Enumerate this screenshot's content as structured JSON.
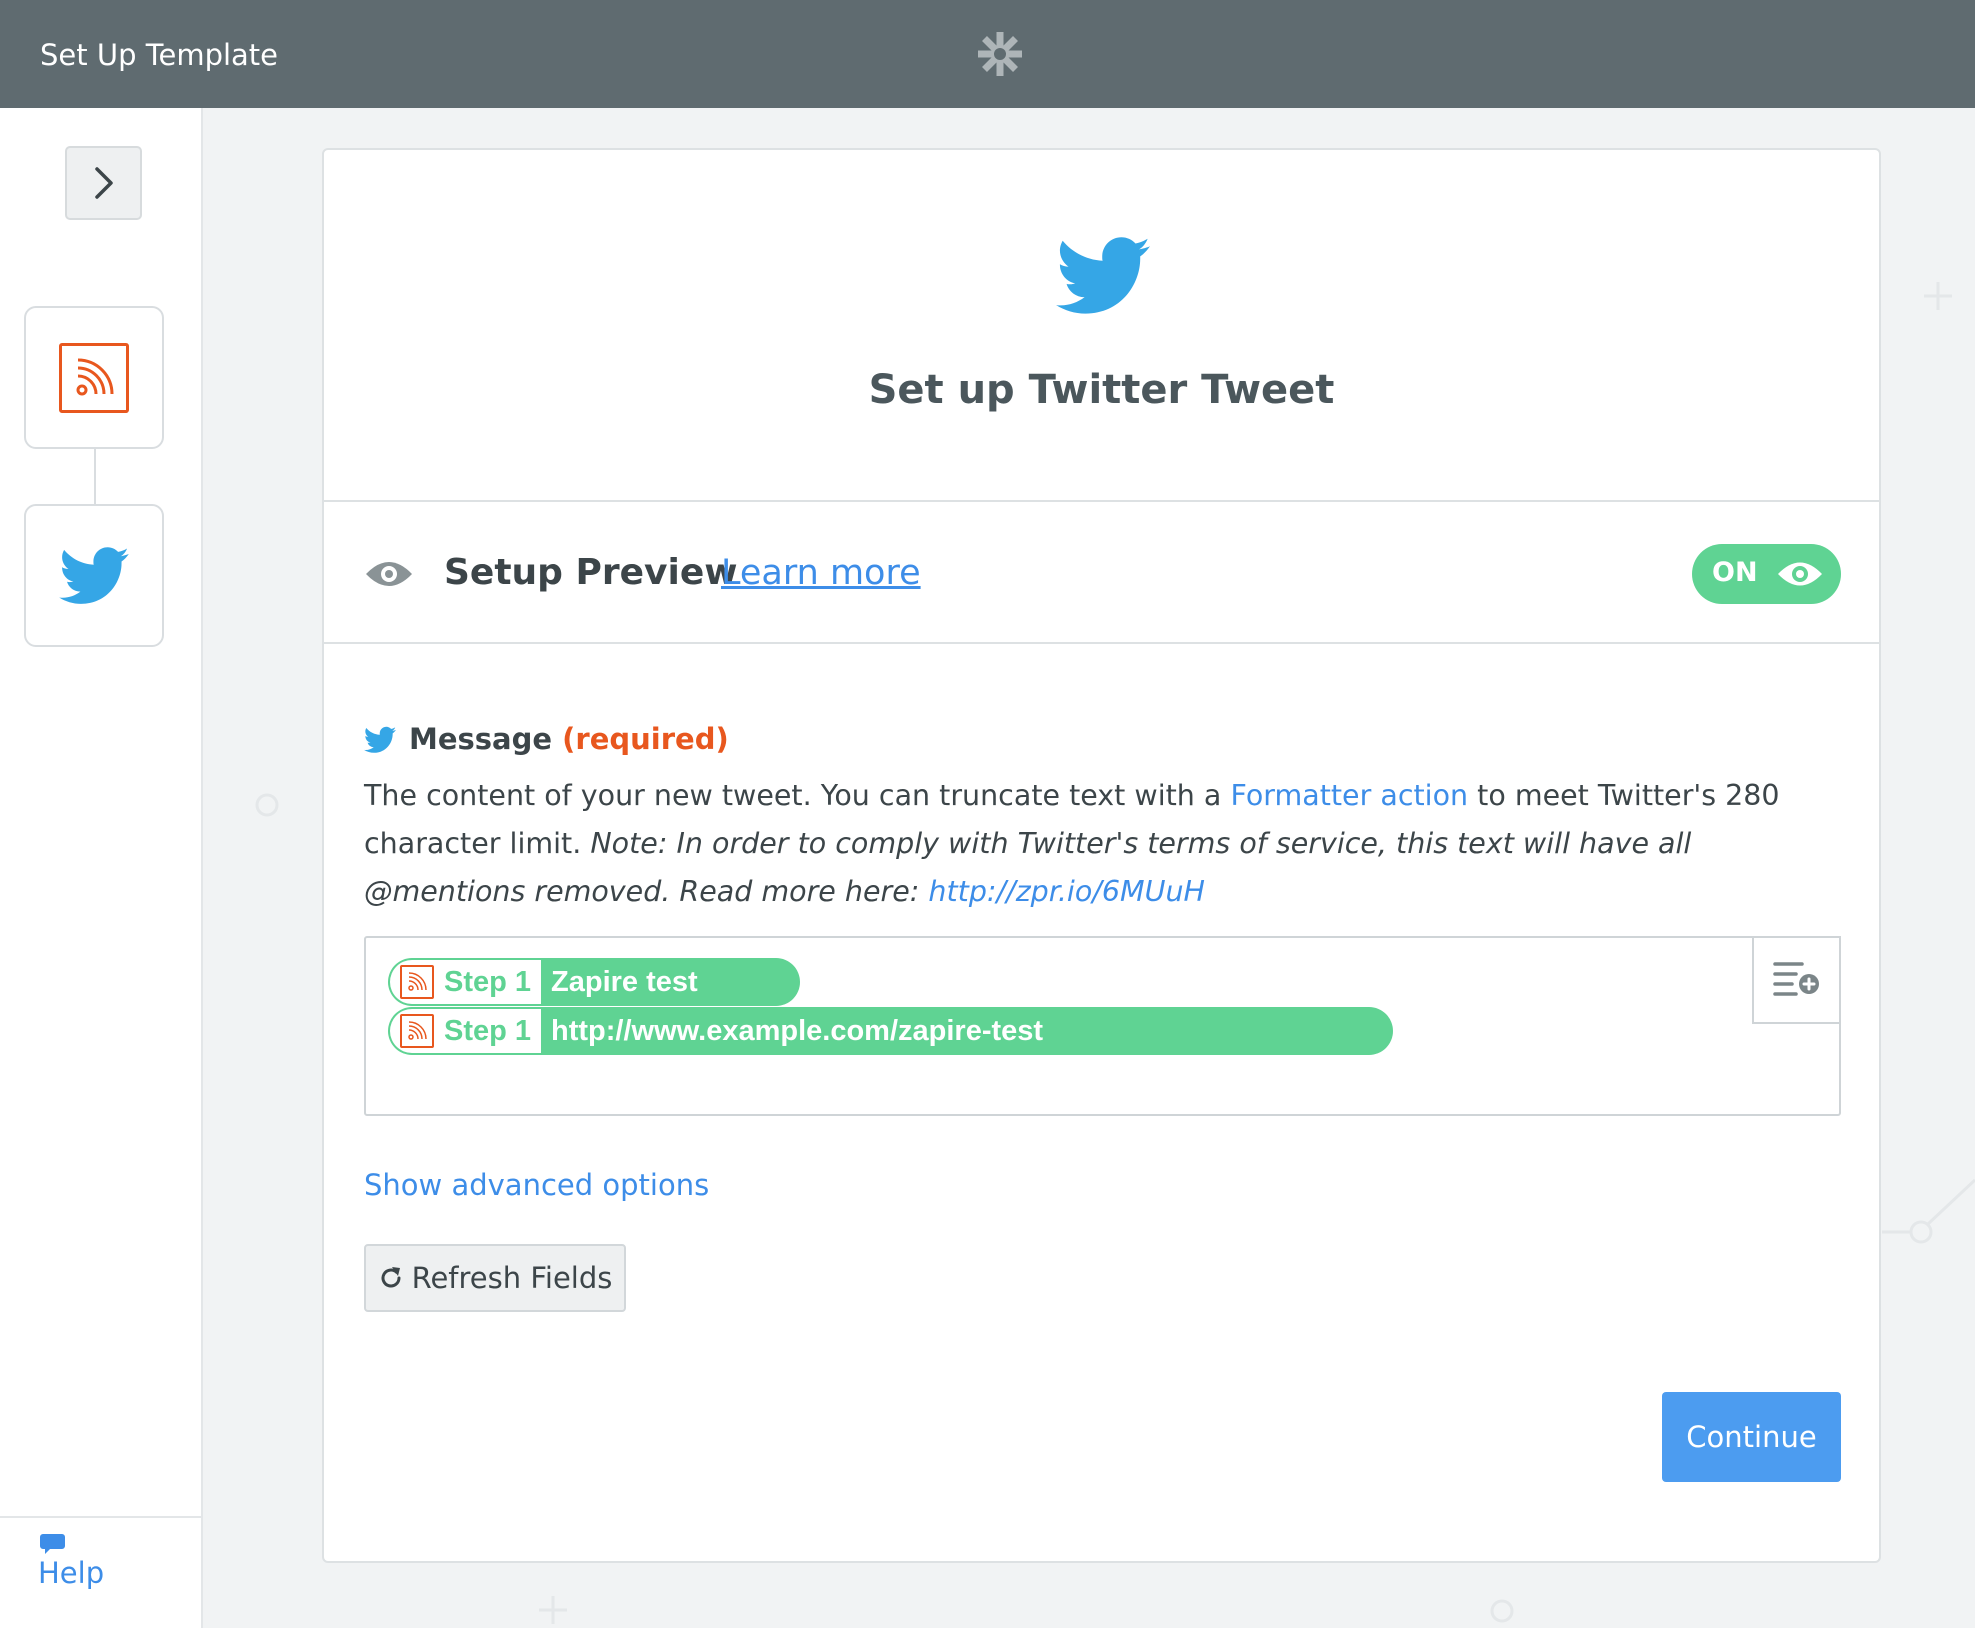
{
  "app": {
    "title": "Set Up Template",
    "logo_icon": "zapier-asterisk-icon"
  },
  "sidebar": {
    "expand_icon": "chevron-right-icon",
    "steps": [
      {
        "app": "RSS",
        "icon": "rss-icon",
        "accent": "#e8571e"
      },
      {
        "app": "Twitter",
        "icon": "twitter-bird-icon",
        "accent": "#35a6e6"
      }
    ],
    "help_label": "Help"
  },
  "card": {
    "title": "Set up Twitter Tweet",
    "preview": {
      "label": "Setup Preview",
      "learn_more": "Learn more",
      "toggle_label": "ON",
      "toggle_color": "#5fd393"
    },
    "field": {
      "label": "Message",
      "required": "(required)",
      "desc_part1": "The content of your new tweet. You can truncate text with a ",
      "desc_link": "Formatter action",
      "desc_part2": " to meet Twitter's 280 character limit. ",
      "desc_note": "Note: In order to comply with Twitter's terms of service, this text will have all @mentions removed. Read more here: ",
      "desc_url": "http://zpr.io/6MUuH",
      "pills": [
        {
          "step": "Step 1",
          "value": "Zapire test"
        },
        {
          "step": "Step 1",
          "value": "http://www.example.com/zapire-test"
        }
      ]
    },
    "show_advanced": "Show advanced options",
    "refresh_label": "Refresh Fields",
    "continue_label": "Continue"
  },
  "colors": {
    "primary_blue": "#4c9cf0",
    "link_blue": "#3d8de8",
    "green": "#5fd393",
    "orange": "#e8571e",
    "header_gray": "#5f6b70"
  }
}
